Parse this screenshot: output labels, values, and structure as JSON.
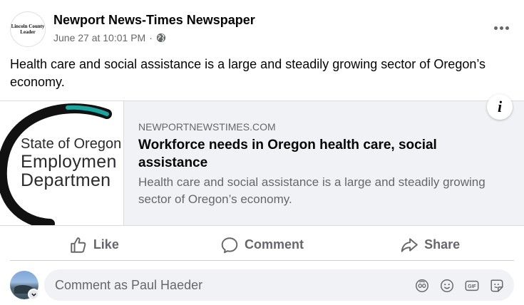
{
  "page": {
    "name": "Newport News-Times Newspaper",
    "avatar_text_line1": "Lincoln County",
    "avatar_text_line2": "Leader",
    "timestamp": "June 27 at 10:01 PM",
    "separator": "·",
    "privacy_icon": "globe-icon",
    "more_icon": "more-options-icon"
  },
  "post": {
    "text": "Health care and social assistance is a large and steadily growing sector of Oregon’s economy."
  },
  "link_preview": {
    "thumbnail_line1": "State of Oregon",
    "thumbnail_line2": "Employmen",
    "thumbnail_line3": "Departmen",
    "domain": "NEWPORTNEWSTIMES.COM",
    "title": "Workforce needs in Oregon health care, social assistance",
    "description": "Health care and social assistance is a large and steadily growing sector of Oregon’s economy.",
    "info_label": "i"
  },
  "actions": {
    "like": "Like",
    "comment": "Comment",
    "share": "Share"
  },
  "comment_composer": {
    "placeholder": "Comment as Paul Haeder",
    "tools": [
      "avatar-sticker-icon",
      "emoji-icon",
      "gif-icon",
      "sticker-icon"
    ]
  },
  "colors": {
    "text_primary": "#050505",
    "text_secondary": "#65676b",
    "card_bg": "#f0f2f5",
    "logo_arc": "#111111",
    "logo_arc_accent": "#1aa6a0"
  }
}
